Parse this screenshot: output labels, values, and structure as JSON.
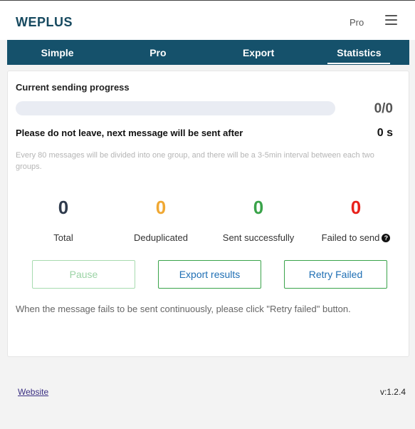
{
  "header": {
    "brand": "WEPLUS",
    "plan_label": "Pro",
    "menu_icon": "hamburger-menu-icon"
  },
  "tabs": [
    {
      "label": "Simple",
      "active": false
    },
    {
      "label": "Pro",
      "active": false
    },
    {
      "label": "Export",
      "active": false
    },
    {
      "label": "Statistics",
      "active": true
    }
  ],
  "progress": {
    "title": "Current sending progress",
    "fraction": 0,
    "count": "0/0",
    "wait_text": "Please do not leave, next message will be sent after",
    "wait_seconds": "0 s",
    "note": "Every 80 messages will be divided into one group, and there will be a 3-5min interval between each two groups."
  },
  "stats": [
    {
      "value": "0",
      "label": "Total",
      "color": "#2f3b4d"
    },
    {
      "value": "0",
      "label": "Deduplicated",
      "color": "#f0a833"
    },
    {
      "value": "0",
      "label": "Sent successfully",
      "color": "#3aa34a"
    },
    {
      "value": "0",
      "label": "Failed to send",
      "color": "#e8211b",
      "help_icon": "question-circle-icon"
    }
  ],
  "buttons": {
    "pause": "Pause",
    "export": "Export results",
    "retry": "Retry Failed"
  },
  "hint": "When the message fails to be sent continuously, please click \"Retry failed\" button.",
  "footer": {
    "website": "Website",
    "version": "v:1.2.4"
  },
  "colors": {
    "brand": "#16495f",
    "tab_bar": "#15516b",
    "button_border": "#3aa34a",
    "button_text": "#1f6fb4"
  }
}
